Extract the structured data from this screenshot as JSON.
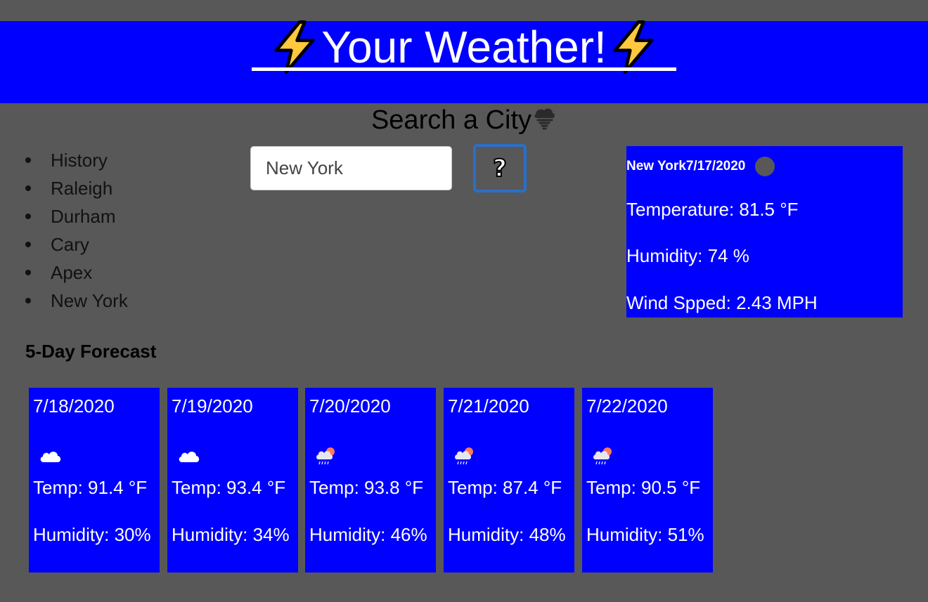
{
  "header": {
    "title": "Your Weather!",
    "left_icon": "lightning-bolt-icon",
    "right_icon": "lightning-bolt-icon"
  },
  "search": {
    "heading": "Search a City",
    "heading_icon": "tornado-icon",
    "input_value": "New York",
    "button_label": "?"
  },
  "history": {
    "items": [
      "History",
      "Raleigh",
      "Durham",
      "Cary",
      "Apex",
      "New York"
    ]
  },
  "current": {
    "city_date": "New York7/17/2020",
    "icon": "weather-icon-placeholder",
    "temperature": "Temperature: 81.5 °F",
    "humidity": "Humidity: 74 %",
    "wind": "Wind Spped: 2.43 MPH"
  },
  "forecast": {
    "title": "5-Day Forecast",
    "days": [
      {
        "date": "7/18/2020",
        "icon": "cloud-icon",
        "temp": "Temp: 91.4 °F",
        "humidity": "Humidity: 30%"
      },
      {
        "date": "7/19/2020",
        "icon": "cloud-icon",
        "temp": "Temp: 93.4 °F",
        "humidity": "Humidity: 34%"
      },
      {
        "date": "7/20/2020",
        "icon": "rain-sun-icon",
        "temp": "Temp: 93.8 °F",
        "humidity": "Humidity: 46%"
      },
      {
        "date": "7/21/2020",
        "icon": "rain-sun-icon",
        "temp": "Temp: 87.4 °F",
        "humidity": "Humidity: 48%"
      },
      {
        "date": "7/22/2020",
        "icon": "rain-sun-icon",
        "temp": "Temp: 90.5 °F",
        "humidity": "Humidity: 51%"
      }
    ]
  },
  "colors": {
    "background": "#585858",
    "panel": "#0000ff",
    "text_light": "#ffffff",
    "focus_ring": "#2a6fc9"
  }
}
